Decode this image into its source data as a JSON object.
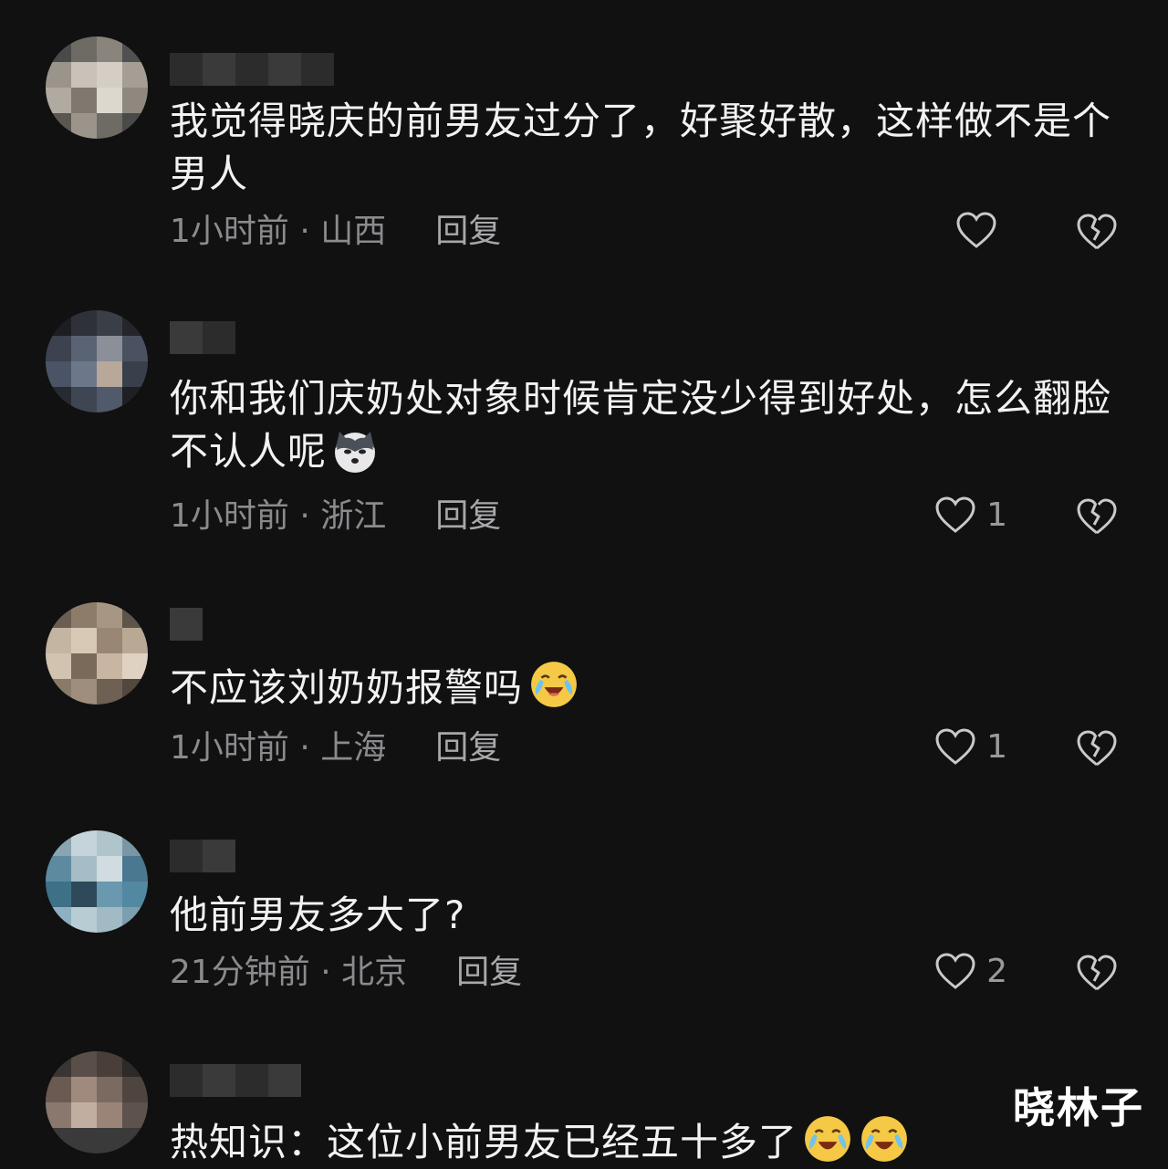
{
  "comments": [
    {
      "text": "我觉得晓庆的前男友过分了，好聚好散，这样做不是个男人",
      "time_location": "1小时前 · 山西",
      "reply_label": "回复",
      "likes": ""
    },
    {
      "text": "你和我们庆奶处对象时候肯定没少得到好处，怎么翻脸不认人呢",
      "emoji": "husky-emoji",
      "time_location": "1小时前 · 浙江",
      "reply_label": "回复",
      "likes": "1"
    },
    {
      "text": "不应该刘奶奶报警吗",
      "emoji": "laugh-cry-emoji",
      "time_location": "1小时前 · 上海",
      "reply_label": "回复",
      "likes": "1"
    },
    {
      "text": "他前男友多大了?",
      "time_location": "21分钟前 · 北京",
      "reply_label": "回复",
      "likes": "2"
    },
    {
      "text": "热知识：这位小前男友已经五十多了",
      "emoji": "laugh-cry-emoji"
    }
  ],
  "watermark": "晓林子",
  "colors": {
    "background": "#111112",
    "text": "#f2f2f2",
    "meta": "#8b8b8e"
  }
}
